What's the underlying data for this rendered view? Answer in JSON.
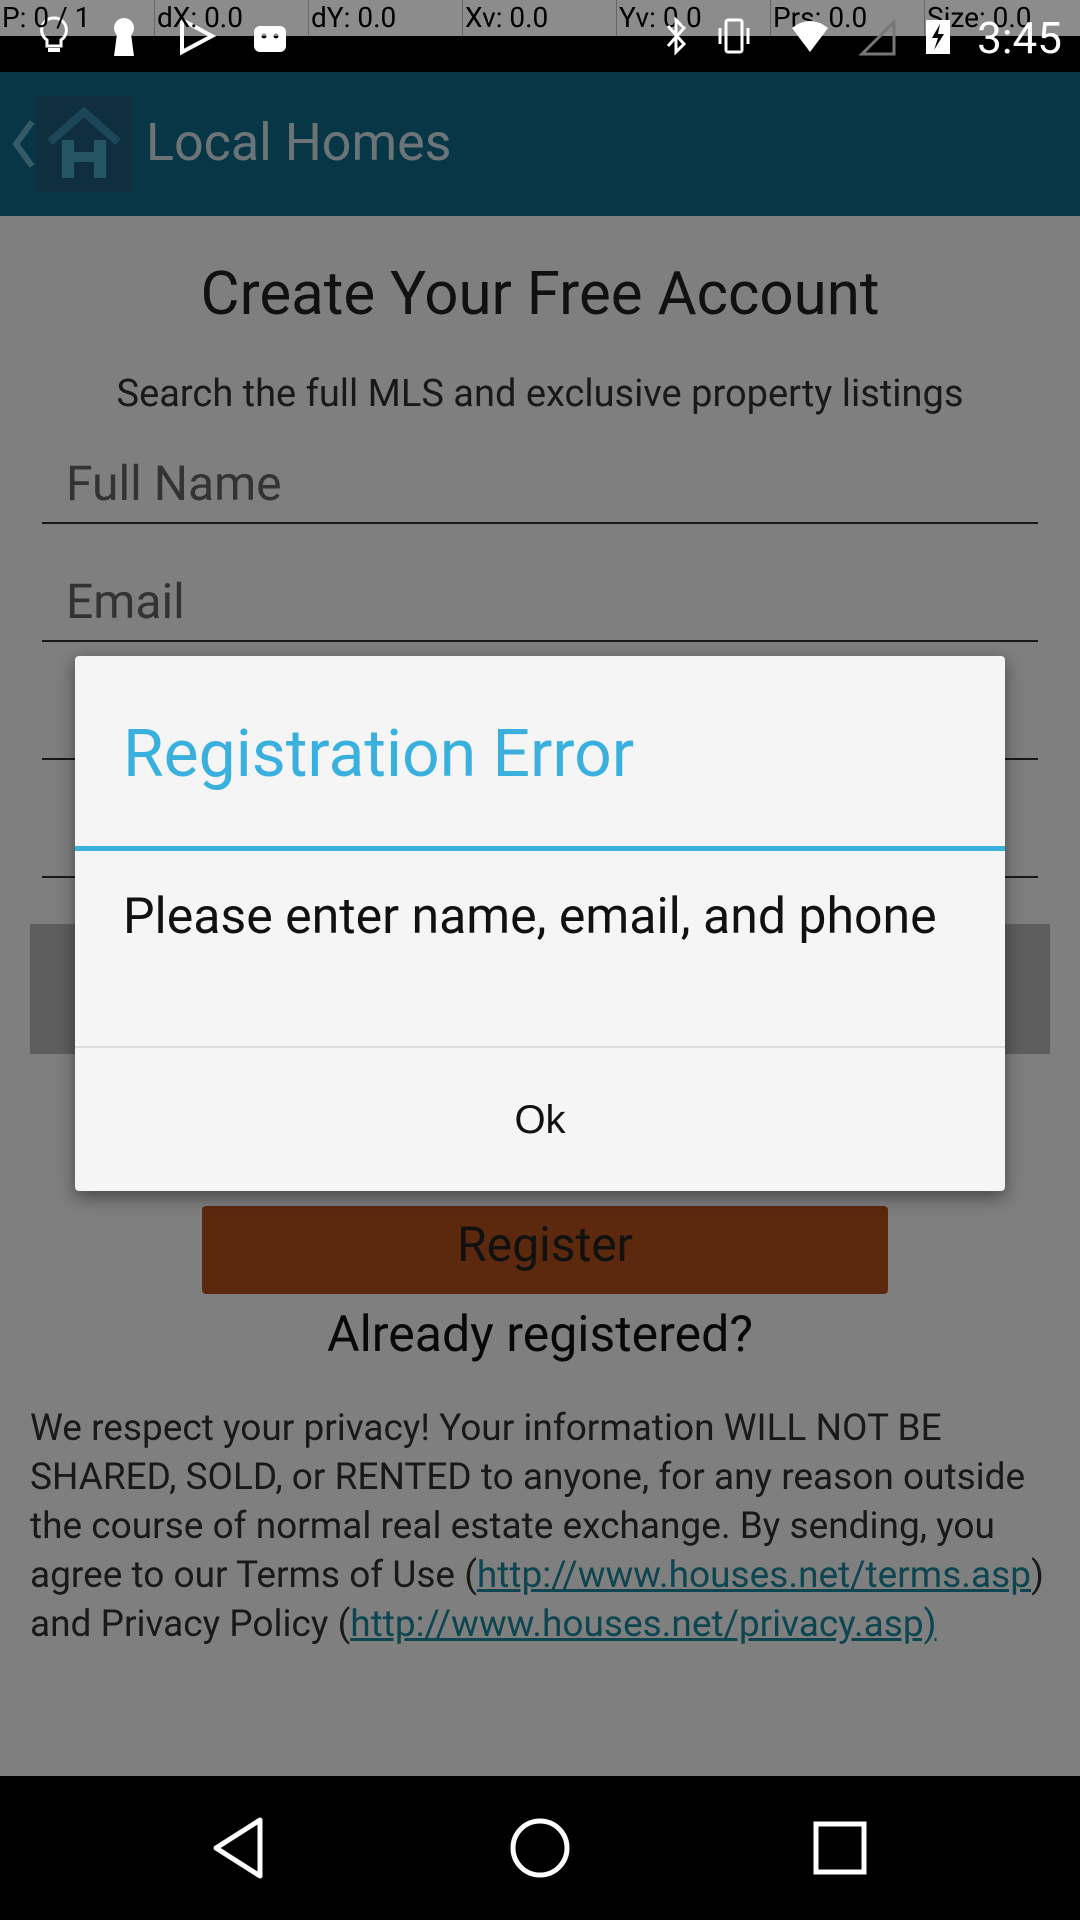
{
  "status_bar": {
    "pointer": {
      "p": "P: 0 / 1",
      "dx": "dX: 0.0",
      "dy": "dY: 0.0",
      "xv": "Xv: 0.0",
      "yv": "Yv: 0.0",
      "prs": "Prs: 0.0",
      "size": "Size: 0.0"
    },
    "time": "3:45",
    "left_icons": [
      "lightbulb-icon",
      "keyhole-icon",
      "play-store-icon",
      "android-icon"
    ],
    "right_icons": [
      "bluetooth-icon",
      "vibrate-icon",
      "wifi-icon",
      "no-signal-icon",
      "battery-charging-icon"
    ]
  },
  "app_bar": {
    "title": "Local Homes",
    "color": "#0f6f8f"
  },
  "form": {
    "heading": "Create Your Free Account",
    "subheading": "Search the full MLS and exclusive property listings",
    "fields": {
      "full_name_placeholder": "Full Name",
      "email_placeholder": "Email"
    },
    "register_label": "Register",
    "already_registered": "Already registered?",
    "privacy": {
      "text_1": "We respect your privacy! Your information WILL NOT BE SHARED, SOLD, or RENTED to anyone, for any reason outside the course of normal real estate exchange. By sending, you agree to our Terms of Use (",
      "terms_link": "http://www.houses.net/terms.asp",
      "text_2": ") and Privacy Policy (",
      "privacy_link": "http://www.houses.net/privacy.asp)"
    }
  },
  "dialog": {
    "title": "Registration Error",
    "message": "Please enter name, email, and phone",
    "ok_label": "Ok",
    "accent_color": "#39b0dd"
  },
  "nav_bar": {
    "icons": [
      "back-icon",
      "home-icon",
      "recents-icon"
    ]
  }
}
